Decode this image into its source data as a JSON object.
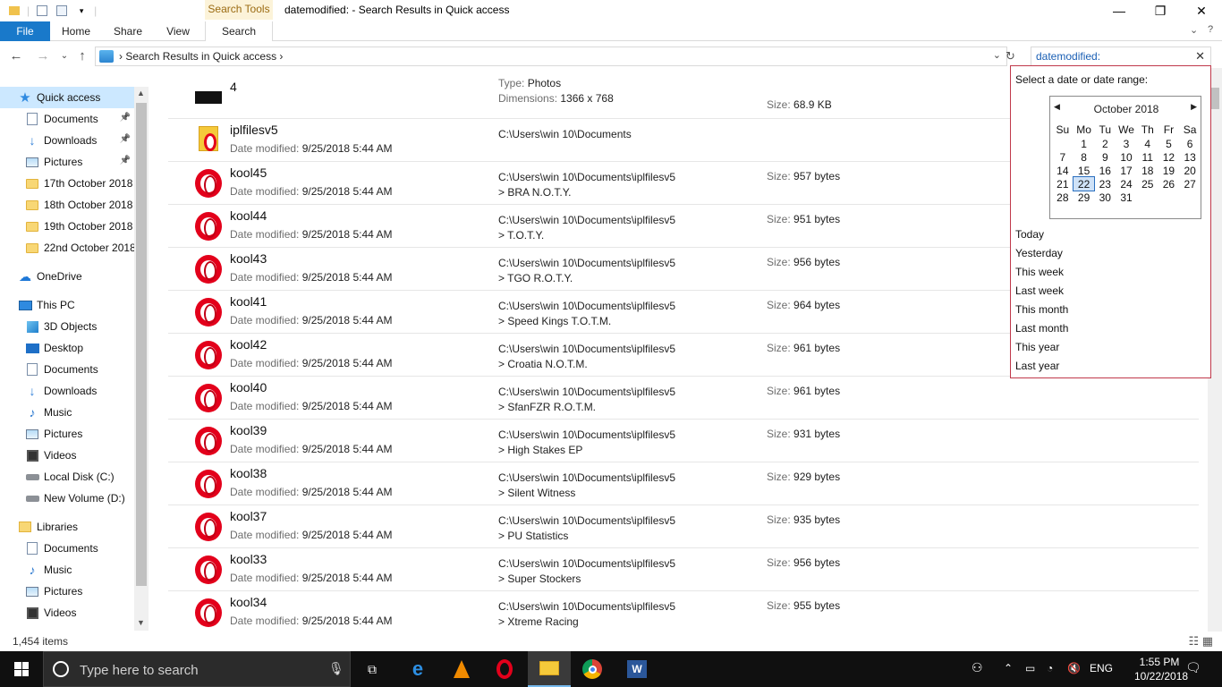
{
  "window": {
    "title": "datemodified: - Search Results in Quick access",
    "context_tab_header": "Search Tools"
  },
  "ribbon": {
    "tabs": [
      "File",
      "Home",
      "Share",
      "View",
      "Search"
    ]
  },
  "address": {
    "breadcrumb": "Search Results in Quick access",
    "search_query": "datemodified:"
  },
  "sidebar": {
    "items": [
      {
        "label": "Quick access",
        "icon": "star-icon",
        "pinned": false
      },
      {
        "label": "Documents",
        "icon": "documents-icon",
        "pinned": true
      },
      {
        "label": "Downloads",
        "icon": "downloads-icon",
        "pinned": true
      },
      {
        "label": "Pictures",
        "icon": "pictures-icon",
        "pinned": true
      },
      {
        "label": "17th October 2018",
        "icon": "folder-icon",
        "pinned": false
      },
      {
        "label": "18th October 2018",
        "icon": "folder-icon",
        "pinned": false
      },
      {
        "label": "19th October 2018",
        "icon": "folder-icon",
        "pinned": false
      },
      {
        "label": "22nd October 2018",
        "icon": "folder-icon",
        "pinned": false
      },
      {
        "label": "OneDrive",
        "icon": "cloud-icon",
        "pinned": false
      },
      {
        "label": "This PC",
        "icon": "computer-icon",
        "pinned": false
      },
      {
        "label": "3D Objects",
        "icon": "cube-icon",
        "pinned": false
      },
      {
        "label": "Desktop",
        "icon": "desktop-icon",
        "pinned": false
      },
      {
        "label": "Documents",
        "icon": "documents-icon",
        "pinned": false
      },
      {
        "label": "Downloads",
        "icon": "downloads-icon",
        "pinned": false
      },
      {
        "label": "Music",
        "icon": "music-icon",
        "pinned": false
      },
      {
        "label": "Pictures",
        "icon": "pictures-icon",
        "pinned": false
      },
      {
        "label": "Videos",
        "icon": "videos-icon",
        "pinned": false
      },
      {
        "label": "Local Disk (C:)",
        "icon": "disk-icon",
        "pinned": false
      },
      {
        "label": "New Volume (D:)",
        "icon": "disk-icon",
        "pinned": false
      },
      {
        "label": "Libraries",
        "icon": "library-icon",
        "pinned": false
      },
      {
        "label": "Documents",
        "icon": "documents-icon",
        "pinned": false
      },
      {
        "label": "Music",
        "icon": "music-icon",
        "pinned": false
      },
      {
        "label": "Pictures",
        "icon": "pictures-icon",
        "pinned": false
      },
      {
        "label": "Videos",
        "icon": "videos-icon",
        "pinned": false
      }
    ]
  },
  "files": [
    {
      "name": "4",
      "icon": "image-thumbnail",
      "meta_label": "Type:",
      "meta_value": "Photos",
      "path": "",
      "sub": "",
      "dims_label": "Dimensions:",
      "dims": "1366 x 768",
      "size_label": "Size:",
      "size": "68.9 KB"
    },
    {
      "name": "iplfilesv5",
      "icon": "folder-icon",
      "meta_label": "Date modified:",
      "meta_value": "9/25/2018 5:44 AM",
      "path": "C:\\Users\\win 10\\Documents",
      "sub": "",
      "size_label": "",
      "size": ""
    },
    {
      "name": "kool45",
      "icon": "opera-icon",
      "meta_label": "Date modified:",
      "meta_value": "9/25/2018 5:44 AM",
      "path": "C:\\Users\\win 10\\Documents\\iplfilesv5",
      "sub": "> BRA N.O.T.Y.",
      "size_label": "Size:",
      "size": "957 bytes"
    },
    {
      "name": "kool44",
      "icon": "opera-icon",
      "meta_label": "Date modified:",
      "meta_value": "9/25/2018 5:44 AM",
      "path": "C:\\Users\\win 10\\Documents\\iplfilesv5",
      "sub": "> T.O.T.Y.",
      "size_label": "Size:",
      "size": "951 bytes"
    },
    {
      "name": "kool43",
      "icon": "opera-icon",
      "meta_label": "Date modified:",
      "meta_value": "9/25/2018 5:44 AM",
      "path": "C:\\Users\\win 10\\Documents\\iplfilesv5",
      "sub": "> TGO R.O.T.Y.",
      "size_label": "Size:",
      "size": "956 bytes"
    },
    {
      "name": "kool41",
      "icon": "opera-icon",
      "meta_label": "Date modified:",
      "meta_value": "9/25/2018 5:44 AM",
      "path": "C:\\Users\\win 10\\Documents\\iplfilesv5",
      "sub": "> Speed Kings T.O.T.M.",
      "size_label": "Size:",
      "size": "964 bytes"
    },
    {
      "name": "kool42",
      "icon": "opera-icon",
      "meta_label": "Date modified:",
      "meta_value": "9/25/2018 5:44 AM",
      "path": "C:\\Users\\win 10\\Documents\\iplfilesv5",
      "sub": "> Croatia N.O.T.M.",
      "size_label": "Size:",
      "size": "961 bytes"
    },
    {
      "name": "kool40",
      "icon": "opera-icon",
      "meta_label": "Date modified:",
      "meta_value": "9/25/2018 5:44 AM",
      "path": "C:\\Users\\win 10\\Documents\\iplfilesv5",
      "sub": "> SfanFZR R.O.T.M.",
      "size_label": "Size:",
      "size": "961 bytes"
    },
    {
      "name": "kool39",
      "icon": "opera-icon",
      "meta_label": "Date modified:",
      "meta_value": "9/25/2018 5:44 AM",
      "path": "C:\\Users\\win 10\\Documents\\iplfilesv5",
      "sub": "> High Stakes EP",
      "size_label": "Size:",
      "size": "931 bytes"
    },
    {
      "name": "kool38",
      "icon": "opera-icon",
      "meta_label": "Date modified:",
      "meta_value": "9/25/2018 5:44 AM",
      "path": "C:\\Users\\win 10\\Documents\\iplfilesv5",
      "sub": "> Silent Witness",
      "size_label": "Size:",
      "size": "929 bytes"
    },
    {
      "name": "kool37",
      "icon": "opera-icon",
      "meta_label": "Date modified:",
      "meta_value": "9/25/2018 5:44 AM",
      "path": "C:\\Users\\win 10\\Documents\\iplfilesv5",
      "sub": "> PU Statistics",
      "size_label": "Size:",
      "size": "935 bytes"
    },
    {
      "name": "kool33",
      "icon": "opera-icon",
      "meta_label": "Date modified:",
      "meta_value": "9/25/2018 5:44 AM",
      "path": "C:\\Users\\win 10\\Documents\\iplfilesv5",
      "sub": "> Super Stockers",
      "size_label": "Size:",
      "size": "956 bytes"
    },
    {
      "name": "kool34",
      "icon": "opera-icon",
      "meta_label": "Date modified:",
      "meta_value": "9/25/2018 5:44 AM",
      "path": "C:\\Users\\win 10\\Documents\\iplfilesv5",
      "sub": "> Xtreme Racing",
      "size_label": "Size:",
      "size": "955 bytes"
    }
  ],
  "datepicker": {
    "title": "Select a date or date range:",
    "month": "October 2018",
    "weekdays": [
      "Su",
      "Mo",
      "Tu",
      "We",
      "Th",
      "Fr",
      "Sa"
    ],
    "weeks": [
      [
        "",
        "1",
        "2",
        "3",
        "4",
        "5",
        "6"
      ],
      [
        "7",
        "8",
        "9",
        "10",
        "11",
        "12",
        "13"
      ],
      [
        "14",
        "15",
        "16",
        "17",
        "18",
        "19",
        "20"
      ],
      [
        "21",
        "22",
        "23",
        "24",
        "25",
        "26",
        "27"
      ],
      [
        "28",
        "29",
        "30",
        "31",
        "",
        "",
        ""
      ]
    ],
    "highlighted_day": "22",
    "ranges": [
      "Today",
      "Yesterday",
      "This week",
      "Last week",
      "This month",
      "Last month",
      "This year",
      "Last year"
    ]
  },
  "status": {
    "item_count": "1,454 items"
  },
  "taskbar": {
    "search_placeholder": "Type here to search",
    "language": "ENG",
    "time": "1:55 PM",
    "date": "10/22/2018"
  },
  "colors": {
    "accent": "#1979ca",
    "selection": "#cce8ff",
    "dropdown_border": "#c0394b"
  }
}
